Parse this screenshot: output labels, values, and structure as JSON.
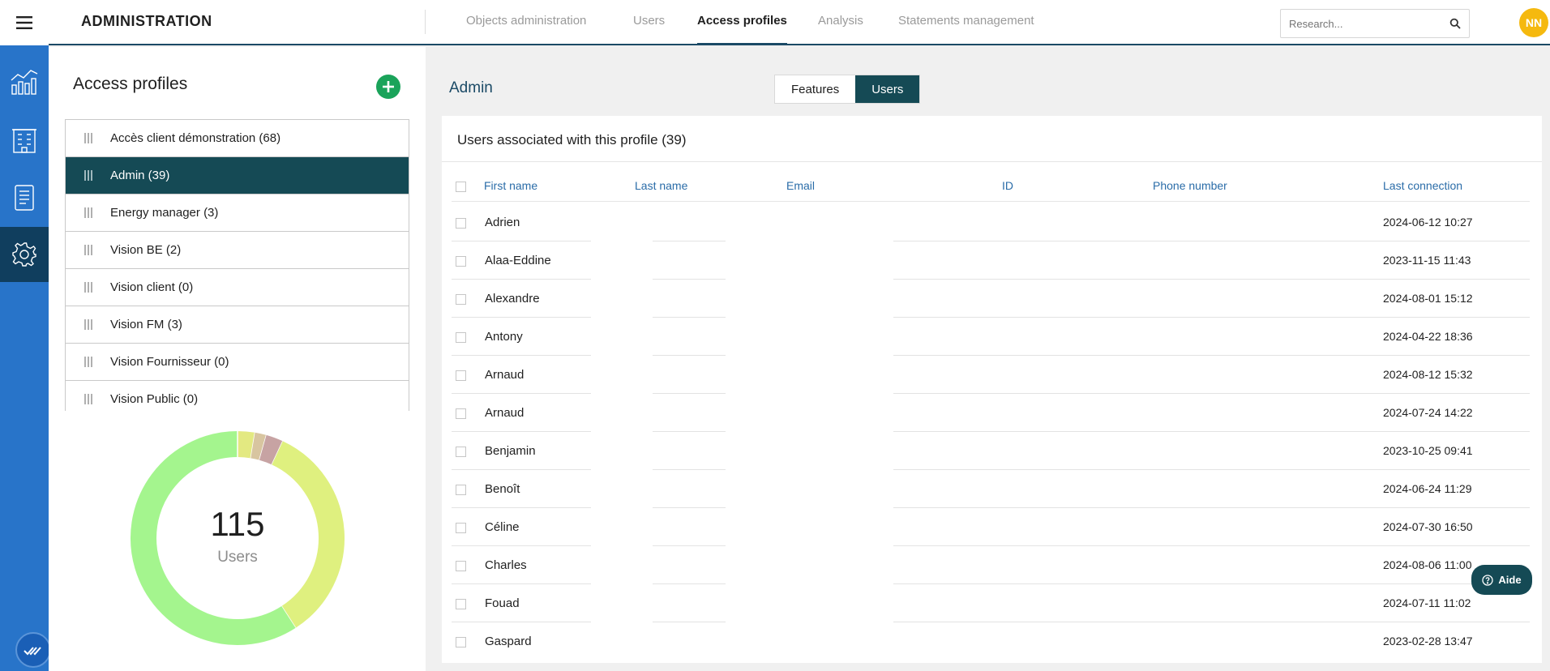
{
  "app": {
    "title": "ADMINISTRATION"
  },
  "nav": {
    "tabs": [
      {
        "label": "Objects administration"
      },
      {
        "label": "Users"
      },
      {
        "label": "Access profiles"
      },
      {
        "label": "Analysis"
      },
      {
        "label": "Statements management"
      }
    ],
    "active_tab": "Access profiles"
  },
  "search": {
    "placeholder": "Research..."
  },
  "user": {
    "initials": "NN"
  },
  "profiles_panel": {
    "title": "Access profiles",
    "items": [
      {
        "label": "Accès client démonstration (68)"
      },
      {
        "label": "Admin (39)"
      },
      {
        "label": "Energy manager (3)"
      },
      {
        "label": "Vision BE (2)"
      },
      {
        "label": "Vision client (0)"
      },
      {
        "label": "Vision FM (3)"
      },
      {
        "label": "Vision Fournisseur (0)"
      },
      {
        "label": "Vision Public (0)"
      }
    ],
    "active_item": "Admin (39)",
    "total_users": "115",
    "total_label": "Users"
  },
  "chart_data": {
    "type": "pie",
    "variant": "donut",
    "center_text": "115",
    "center_label": "Users",
    "values": [
      68,
      39,
      3,
      2,
      3
    ],
    "colors": [
      "#a4f58e",
      "#dff07f",
      "#e3e981",
      "#d8c5a0",
      "#c7a3a3"
    ]
  },
  "detail": {
    "profile_name": "Admin",
    "segments": [
      {
        "label": "Features"
      },
      {
        "label": "Users"
      }
    ],
    "active_segment": "Users",
    "card_title": "Users associated with this profile (39)",
    "columns": [
      {
        "label": "First name"
      },
      {
        "label": "Last name"
      },
      {
        "label": "Email"
      },
      {
        "label": "ID"
      },
      {
        "label": "Phone number"
      },
      {
        "label": "Last connection"
      }
    ],
    "rows": [
      {
        "first_name": "Adrien",
        "last_connection": "2024-06-12 10:27"
      },
      {
        "first_name": "Alaa-Eddine",
        "last_connection": "2023-11-15 11:43"
      },
      {
        "first_name": "Alexandre",
        "last_connection": "2024-08-01 15:12"
      },
      {
        "first_name": "Antony",
        "last_connection": "2024-04-22 18:36"
      },
      {
        "first_name": "Arnaud",
        "last_connection": "2024-08-12 15:32"
      },
      {
        "first_name": "Arnaud",
        "last_connection": "2024-07-24 14:22"
      },
      {
        "first_name": "Benjamin",
        "last_connection": "2023-10-25 09:41"
      },
      {
        "first_name": "Benoît",
        "last_connection": "2024-06-24 11:29"
      },
      {
        "first_name": "Céline",
        "last_connection": "2024-07-30 16:50"
      },
      {
        "first_name": "Charles",
        "last_connection": "2024-08-06 11:00"
      },
      {
        "first_name": "Fouad",
        "last_connection": "2024-07-11 11:02"
      },
      {
        "first_name": "Gaspard",
        "last_connection": "2023-02-28 13:47"
      }
    ]
  },
  "help": {
    "label": "Aide"
  },
  "icons": [
    "menu-icon",
    "analytics-icon",
    "building-icon",
    "document-icon",
    "settings-icon",
    "check-icon",
    "search-icon",
    "add-icon",
    "drag-handle-icon",
    "help-icon"
  ]
}
